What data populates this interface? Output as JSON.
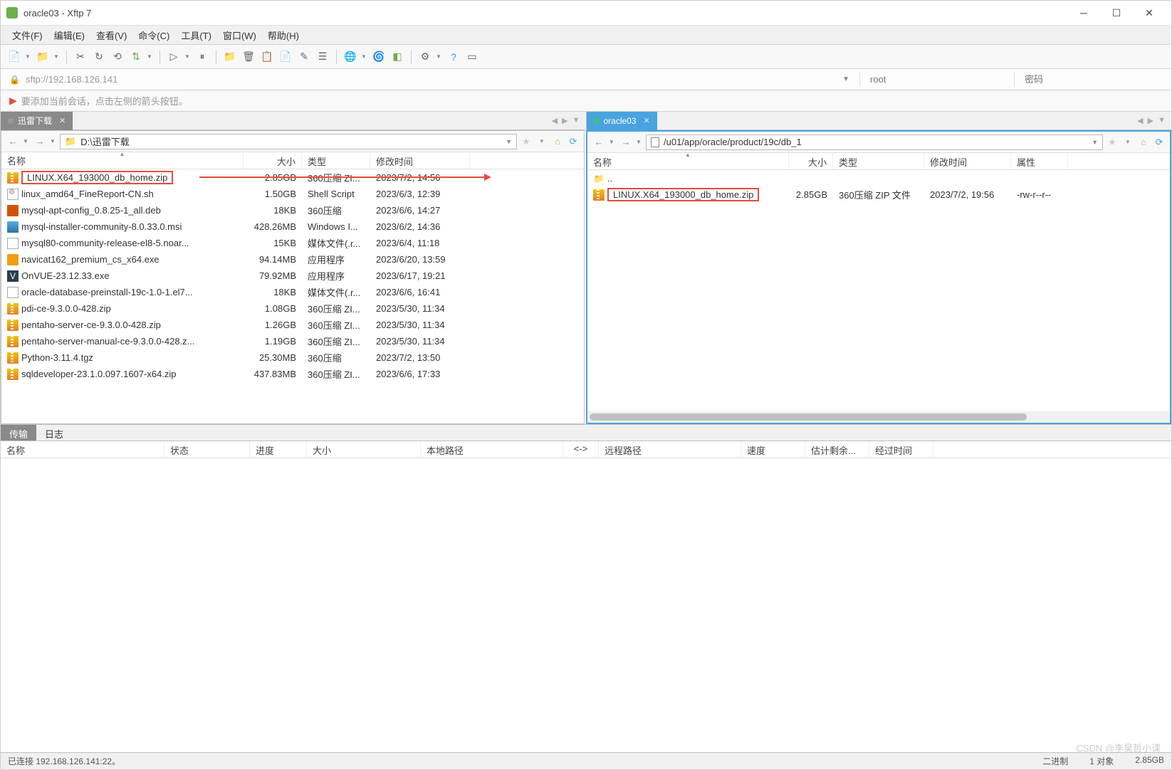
{
  "window": {
    "title": "oracle03 - Xftp 7"
  },
  "menu": {
    "file": "文件(F)",
    "edit": "编辑(E)",
    "view": "查看(V)",
    "command": "命令(C)",
    "tools": "工具(T)",
    "window": "窗口(W)",
    "help": "帮助(H)"
  },
  "address": {
    "url": "sftp://192.168.126.141",
    "user_placeholder": "root",
    "pass_placeholder": "密码"
  },
  "hint": "要添加当前会话，点击左侧的箭头按钮。",
  "tabs": {
    "left": {
      "label": "迅雷下载"
    },
    "right": {
      "label": "oracle03"
    }
  },
  "left_pane": {
    "path": "D:\\迅雷下载",
    "headers": {
      "name": "名称",
      "size": "大小",
      "type": "类型",
      "date": "修改时间"
    },
    "files": [
      {
        "name": "LINUX.X64_193000_db_home.zip",
        "size": "2.85GB",
        "type": "360压缩 ZI...",
        "date": "2023/7/2, 14:56",
        "icon": "zip",
        "hl": true
      },
      {
        "name": "linux_amd64_FineReport-CN.sh",
        "size": "1.50GB",
        "type": "Shell Script",
        "date": "2023/6/3, 12:39",
        "icon": "sh"
      },
      {
        "name": "mysql-apt-config_0.8.25-1_all.deb",
        "size": "18KB",
        "type": "360压缩",
        "date": "2023/6/6, 14:27",
        "icon": "deb"
      },
      {
        "name": "mysql-installer-community-8.0.33.0.msi",
        "size": "428.26MB",
        "type": "Windows I...",
        "date": "2023/6/2, 14:36",
        "icon": "msi"
      },
      {
        "name": "mysql80-community-release-el8-5.noar...",
        "size": "15KB",
        "type": "媒体文件(.r...",
        "date": "2023/6/4, 11:18",
        "icon": "file"
      },
      {
        "name": "navicat162_premium_cs_x64.exe",
        "size": "94.14MB",
        "type": "应用程序",
        "date": "2023/6/20, 13:59",
        "icon": "exe"
      },
      {
        "name": "OnVUE-23.12.33.exe",
        "size": "79.92MB",
        "type": "应用程序",
        "date": "2023/6/17, 19:21",
        "icon": "exe2"
      },
      {
        "name": "oracle-database-preinstall-19c-1.0-1.el7...",
        "size": "18KB",
        "type": "媒体文件(.r...",
        "date": "2023/6/6, 16:41",
        "icon": "file"
      },
      {
        "name": "pdi-ce-9.3.0.0-428.zip",
        "size": "1.08GB",
        "type": "360压缩 ZI...",
        "date": "2023/5/30, 11:34",
        "icon": "zip"
      },
      {
        "name": "pentaho-server-ce-9.3.0.0-428.zip",
        "size": "1.26GB",
        "type": "360压缩 ZI...",
        "date": "2023/5/30, 11:34",
        "icon": "zip"
      },
      {
        "name": "pentaho-server-manual-ce-9.3.0.0-428.z...",
        "size": "1.19GB",
        "type": "360压缩 ZI...",
        "date": "2023/5/30, 11:34",
        "icon": "zip"
      },
      {
        "name": "Python-3.11.4.tgz",
        "size": "25.30MB",
        "type": "360压缩",
        "date": "2023/7/2, 13:50",
        "icon": "zip"
      },
      {
        "name": "sqldeveloper-23.1.0.097.1607-x64.zip",
        "size": "437.83MB",
        "type": "360压缩 ZI...",
        "date": "2023/6/6, 17:33",
        "icon": "zip"
      }
    ]
  },
  "right_pane": {
    "path": "/u01/app/oracle/product/19c/db_1",
    "headers": {
      "name": "名称",
      "size": "大小",
      "type": "类型",
      "date": "修改时间",
      "attr": "属性"
    },
    "parent": "..",
    "files": [
      {
        "name": "LINUX.X64_193000_db_home.zip",
        "size": "2.85GB",
        "type": "360压缩 ZIP 文件",
        "date": "2023/7/2, 19:56",
        "attr": "-rw-r--r--",
        "icon": "zip",
        "hl": true
      }
    ]
  },
  "bottom": {
    "tab_transfer": "传输",
    "tab_log": "日志",
    "headers": {
      "name": "名称",
      "status": "状态",
      "progress": "进度",
      "size": "大小",
      "local": "本地路径",
      "dir": "<->",
      "remote": "远程路径",
      "speed": "速度",
      "remain": "估计剩余...",
      "elapsed": "经过时间"
    }
  },
  "status": {
    "conn": "已连接 192.168.126.141:22。",
    "binary": "二进制",
    "objects": "1 对象",
    "size": "2.85GB"
  },
  "watermark": "CSDN @李昊哲小课"
}
